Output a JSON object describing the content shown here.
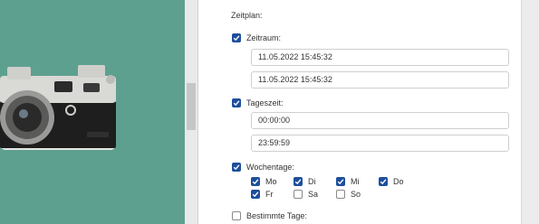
{
  "schedule": {
    "title": "Zeitplan:",
    "period": {
      "label": "Zeitraum:",
      "checked": true,
      "from": "11.05.2022 15:45:32",
      "to": "11.05.2022 15:45:32"
    },
    "daytime": {
      "label": "Tageszeit:",
      "checked": true,
      "from": "00:00:00",
      "to": "23:59:59"
    },
    "weekdays": {
      "label": "Wochentage:",
      "checked": true,
      "days": [
        {
          "label": "Mo",
          "checked": true
        },
        {
          "label": "Di",
          "checked": true
        },
        {
          "label": "Mi",
          "checked": true
        },
        {
          "label": "Do",
          "checked": true
        },
        {
          "label": "Fr",
          "checked": true
        },
        {
          "label": "Sa",
          "checked": false
        },
        {
          "label": "So",
          "checked": false
        }
      ]
    },
    "specific_days": {
      "label": "Bestimmte Tage:",
      "checked": false
    }
  },
  "colors": {
    "accent": "#1e4f9c",
    "left_background": "#5ea08f"
  }
}
